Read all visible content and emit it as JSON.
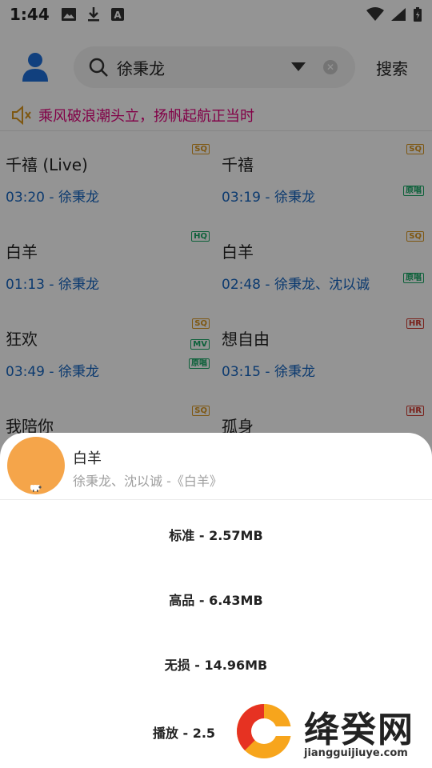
{
  "status_bar": {
    "time": "1:44"
  },
  "search": {
    "query": "徐秉龙",
    "button_label": "搜索"
  },
  "notice": {
    "text": "乘风破浪潮头立，扬帆起航正当时"
  },
  "songs": [
    {
      "title": "千禧 (Live)",
      "duration": "03:20",
      "artist": "徐秉龙",
      "badges": [
        "SQ"
      ]
    },
    {
      "title": "千禧",
      "duration": "03:19",
      "artist": "徐秉龙",
      "badges": [
        "SQ",
        "原唱"
      ]
    },
    {
      "title": "白羊",
      "duration": "01:13",
      "artist": "徐秉龙",
      "badges": [
        "HQ"
      ]
    },
    {
      "title": "白羊",
      "duration": "02:48",
      "artist": "徐秉龙、沈以诚",
      "badges": [
        "SQ",
        "原唱"
      ]
    },
    {
      "title": "狂欢",
      "duration": "03:49",
      "artist": "徐秉龙",
      "badges": [
        "SQ",
        "MV",
        "原唱"
      ]
    },
    {
      "title": "想自由",
      "duration": "03:15",
      "artist": "徐秉龙",
      "badges": [
        "HR"
      ]
    },
    {
      "title": "我陪你",
      "duration": "",
      "artist": "",
      "badges": [
        "SQ"
      ]
    },
    {
      "title": "孤身",
      "duration": "",
      "artist": "",
      "badges": [
        "HR"
      ]
    }
  ],
  "sheet": {
    "title": "白羊",
    "subtitle": "徐秉龙、沈以诚 -《白羊》",
    "options": [
      "标准 - 2.57MB",
      "高品 - 6.43MB",
      "无损 - 14.96MB",
      "播放 - 2.5"
    ]
  },
  "watermark": {
    "name": "绛癸网",
    "url": "jiangguijiuye.com"
  },
  "colors": {
    "accent": "#1565c0",
    "notice": "#e0007a",
    "sq": "#d99620",
    "hq": "#17a765",
    "hr": "#d03a2f",
    "cover": "#f5a54a"
  }
}
